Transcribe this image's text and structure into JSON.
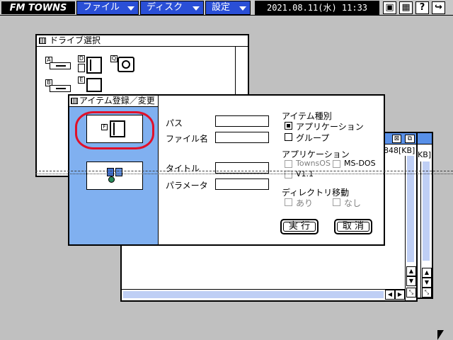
{
  "menubar": {
    "logo": "FM TOWNS",
    "menus": [
      "ファイル",
      "ディスク",
      "設定"
    ],
    "clock": "2021.08.11(水) 11:33",
    "icons": [
      "disk-icon",
      "grid-icon",
      "help-icon",
      "exit-icon"
    ],
    "icon_glyphs": [
      "▣",
      "▦",
      "?",
      "↪"
    ]
  },
  "drive_window": {
    "title": "ドライブ選択",
    "drive_letters": [
      "A",
      "D",
      "Q",
      "B",
      "E"
    ]
  },
  "back_window": {
    "size_label": "848[KB]",
    "size_label_2": "KB]"
  },
  "dialog": {
    "title": "アイテム登録／変更",
    "icon_letter": "F",
    "labels": {
      "path": "パス",
      "filename": "ファイル名",
      "title": "タイトル",
      "params": "パラメータ"
    },
    "item_type": {
      "heading": "アイテム種別",
      "options": [
        "アプリケーション",
        "グループ"
      ],
      "selected": 0
    },
    "application": {
      "heading": "アプリケーション",
      "options": [
        "TownsOS",
        "MS-DOS",
        "V1.1"
      ]
    },
    "dir_move": {
      "heading": "ディレクトリ移動",
      "options": [
        "あり",
        "なし"
      ]
    },
    "buttons": {
      "ok": "実 行",
      "cancel": "取 消"
    }
  },
  "colors": {
    "menu_blue": "#2a4fd6",
    "dialog_side": "#80b0f0",
    "highlight_red": "#e0102a",
    "desktop": "#c0c0c0"
  }
}
